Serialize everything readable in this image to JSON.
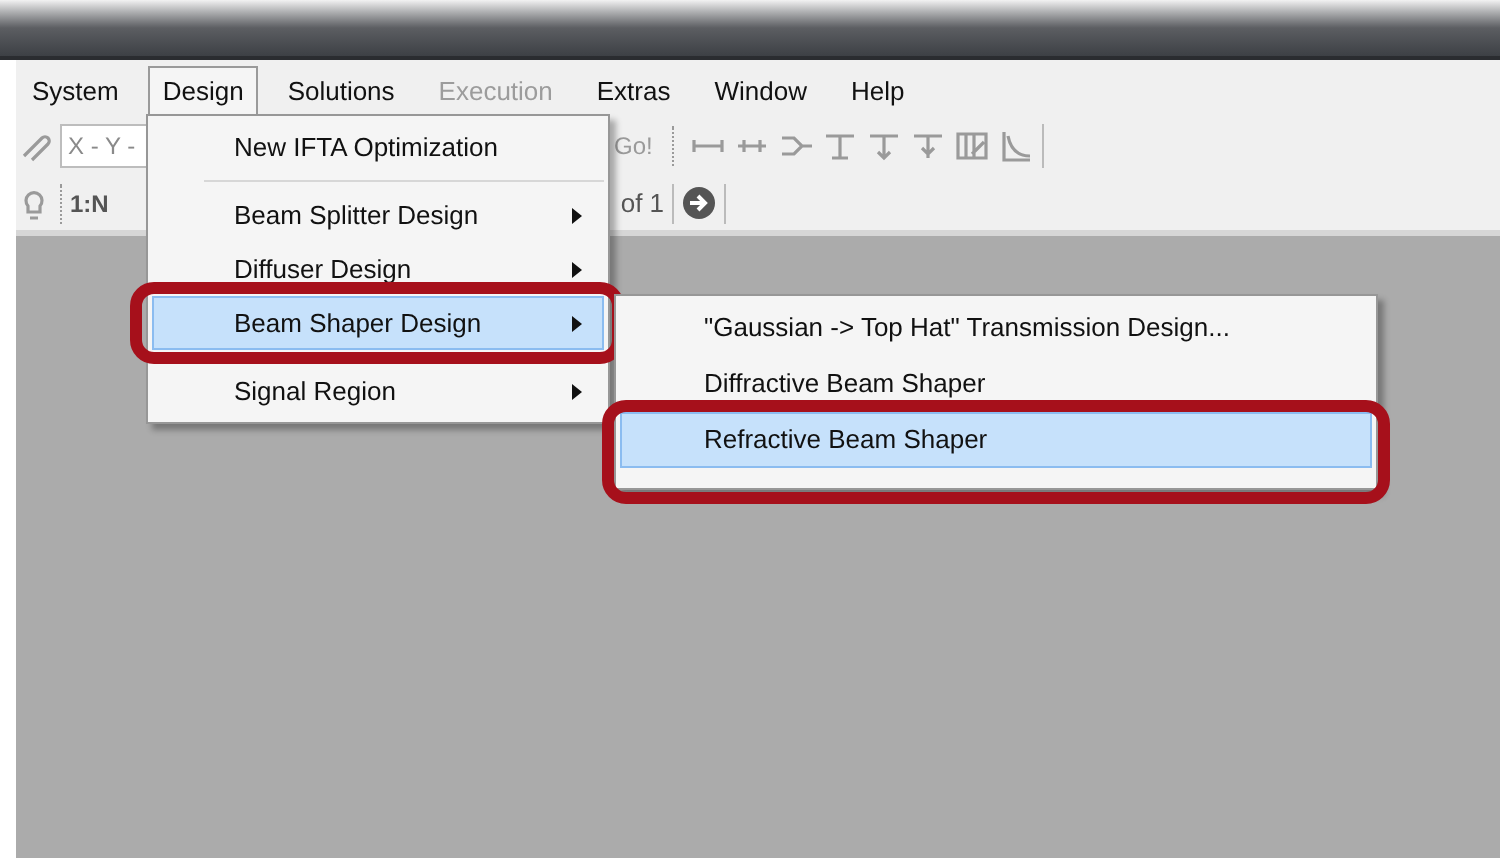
{
  "menubar": [
    {
      "label": "System",
      "selected": false,
      "disabled": false
    },
    {
      "label": "Design",
      "selected": true,
      "disabled": false
    },
    {
      "label": "Solutions",
      "selected": false,
      "disabled": false
    },
    {
      "label": "Execution",
      "selected": false,
      "disabled": true
    },
    {
      "label": "Extras",
      "selected": false,
      "disabled": false
    },
    {
      "label": "Window",
      "selected": false,
      "disabled": false
    },
    {
      "label": "Help",
      "selected": false,
      "disabled": false
    }
  ],
  "toolbar": {
    "combo_text": "X - Y -",
    "go_button": "Go!",
    "ratio_text": "1:N",
    "page_text": "of 1"
  },
  "design_menu": [
    {
      "kind": "item",
      "label": "New IFTA Optimization",
      "submenu": false,
      "selected": false
    },
    {
      "kind": "separator"
    },
    {
      "kind": "item",
      "label": "Beam Splitter Design",
      "submenu": true,
      "selected": false
    },
    {
      "kind": "item",
      "label": "Diffuser Design",
      "submenu": true,
      "selected": false
    },
    {
      "kind": "item",
      "label": "Beam Shaper Design",
      "submenu": true,
      "selected": true
    },
    {
      "kind": "separator"
    },
    {
      "kind": "item",
      "label": "Signal Region",
      "submenu": true,
      "selected": false
    }
  ],
  "beam_shaper_menu": [
    {
      "label": "\"Gaussian -> Top Hat\" Transmission Design...",
      "selected": false
    },
    {
      "label": "Diffractive Beam Shaper",
      "selected": false
    },
    {
      "label": "Refractive Beam Shaper",
      "selected": true
    }
  ]
}
